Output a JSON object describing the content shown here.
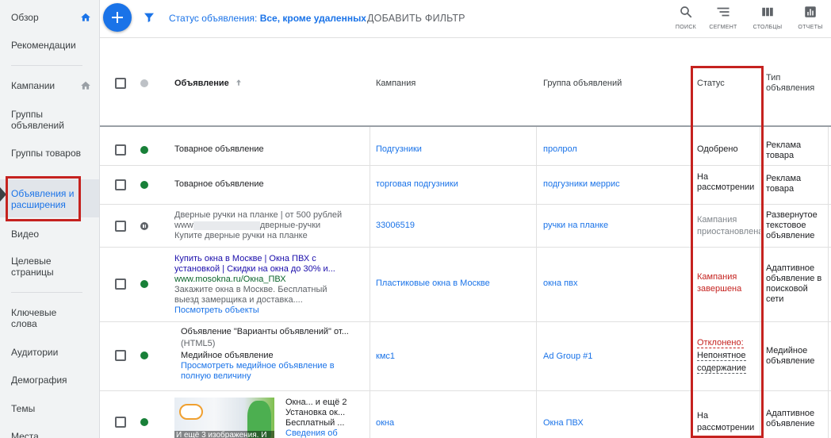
{
  "sidebar": {
    "items": [
      {
        "label": "Обзор"
      },
      {
        "label": "Рекомендации"
      },
      {
        "label": "Кампании"
      },
      {
        "label": "Группы объявлений"
      },
      {
        "label": "Группы товаров"
      },
      {
        "label": "Объявления и расширения"
      },
      {
        "label": "Видео"
      },
      {
        "label": "Целевые страницы"
      },
      {
        "label": "Ключевые слова"
      },
      {
        "label": "Аудитории"
      },
      {
        "label": "Демография"
      },
      {
        "label": "Темы"
      },
      {
        "label": "Места"
      }
    ]
  },
  "toolbar": {
    "status_prefix": "Статус объявления: ",
    "status_value": "Все, кроме удаленных",
    "add_filter": "ДОБАВИТЬ ФИЛЬТР",
    "tools": [
      {
        "label": "ПОИСК",
        "icon": "search-icon"
      },
      {
        "label": "СЕГМЕНТ",
        "icon": "segment-icon"
      },
      {
        "label": "СТОЛБЦЫ",
        "icon": "columns-icon"
      },
      {
        "label": "ОТЧЕТЫ",
        "icon": "reports-icon"
      }
    ]
  },
  "table": {
    "headers": {
      "ad": "Объявление",
      "campaign": "Кампания",
      "adgroup": "Группа объявлений",
      "status": "Статус",
      "type": "Тип объявления"
    },
    "rows": [
      {
        "ad": "Товарное объявление",
        "campaign": "Подгузники",
        "adgroup": "пролрол",
        "status": "Одобрено",
        "type": "Реклама товара"
      },
      {
        "ad": "Товарное объявление",
        "campaign": "торговая подгузники",
        "adgroup": "подгузники меррис",
        "status": "На рассмотрении",
        "type": "Реклама товара"
      },
      {
        "ad_line1": "Дверные ручки на планке | от 500 рублей",
        "ad_line2_prefix": "www",
        "ad_line2_suffix": "дверные-ручки",
        "ad_line3": "Купите дверные ручки на планке",
        "campaign": "33006519",
        "adgroup": "ручки на планке",
        "status": "Кампания приостановлена",
        "type": "Развернутое текстовое объявление"
      },
      {
        "ad_title1": "Купить окна в Москве | Окна ПВХ с",
        "ad_title2": "установкой | Скидки на окна до 30% и...",
        "ad_url": "www.mosokna.ru/Окна_ПВХ",
        "ad_desc1": "Закажите окна в Москве. Бесплатный",
        "ad_desc2": "выезд замерщика и доставка....",
        "ad_link": "Посмотреть объекты",
        "campaign": "Пластиковые окна в Москве",
        "adgroup": "окна пвх",
        "status": "Кампания завершена",
        "type": "Адаптивное объявление в поисковой сети"
      },
      {
        "ad_line1": "Объявление \"Варианты объявлений\" от...",
        "ad_line2": "(HTML5)",
        "ad_line3": "Медийное объявление",
        "ad_link": "Просмотреть медийное объявление в полную величину",
        "campaign": "кмс1",
        "adgroup": "Ad Group #1",
        "status_label": "Отклонено:",
        "status_reason": "Непонятное содержание",
        "type": "Медийное объявление"
      },
      {
        "thumb_caption": "И ещё 3 изображения. И",
        "ad_line1": "Окна... и ещё 2",
        "ad_line2": "Установка ок...",
        "ad_line3": "Бесплатный ...",
        "ad_link": "Сведения об",
        "campaign": "окна",
        "adgroup": "Окна ПВХ",
        "status": "На рассмотрении",
        "type": "Адаптивное объявление"
      }
    ]
  },
  "colors": {
    "accent": "#1a73e8",
    "highlight": "#c5221f",
    "status_green": "#188038"
  }
}
